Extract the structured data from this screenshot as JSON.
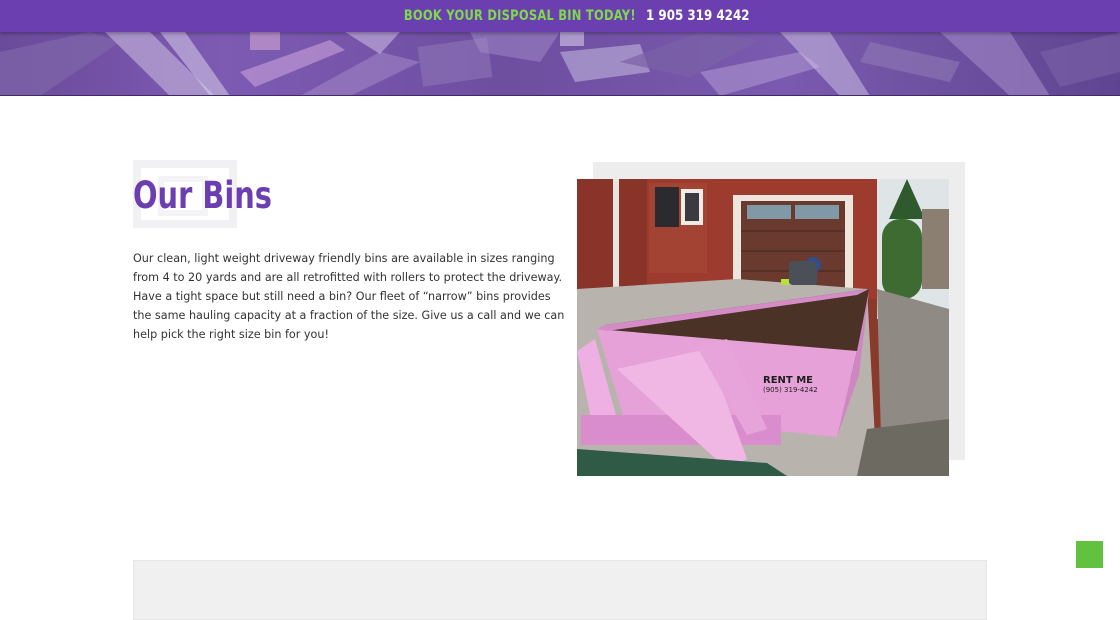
{
  "top_bar": {
    "promo_text": "BOOK YOUR DISPOSAL BIN TODAY!",
    "phone": "1 905 319 4242",
    "background_color": "#6b3fb0",
    "promo_color": "#7ddb4a"
  },
  "hero": {
    "image_icon": "debris-banner-image"
  },
  "section": {
    "title": "Our Bins",
    "title_color": "#6b3fb0",
    "description": "Our clean, light weight driveway friendly bins are available in sizes ranging from 4 to 20 yards and are all retrofitted with rollers to protect the driveway. Have a tight space but still need a bin? Our fleet of “narrow” bins provides the same hauling capacity at a fraction of the size. Give us a call and we can help pick the right size bin for you!"
  },
  "photo": {
    "image_icon": "pink-disposal-bin-photo",
    "bin_label_main": "RENT ME",
    "bin_label_phone": "(905) 319-4242"
  },
  "scroll_top_button": {
    "icon": "scroll-to-top-icon",
    "color": "#62c13e"
  }
}
